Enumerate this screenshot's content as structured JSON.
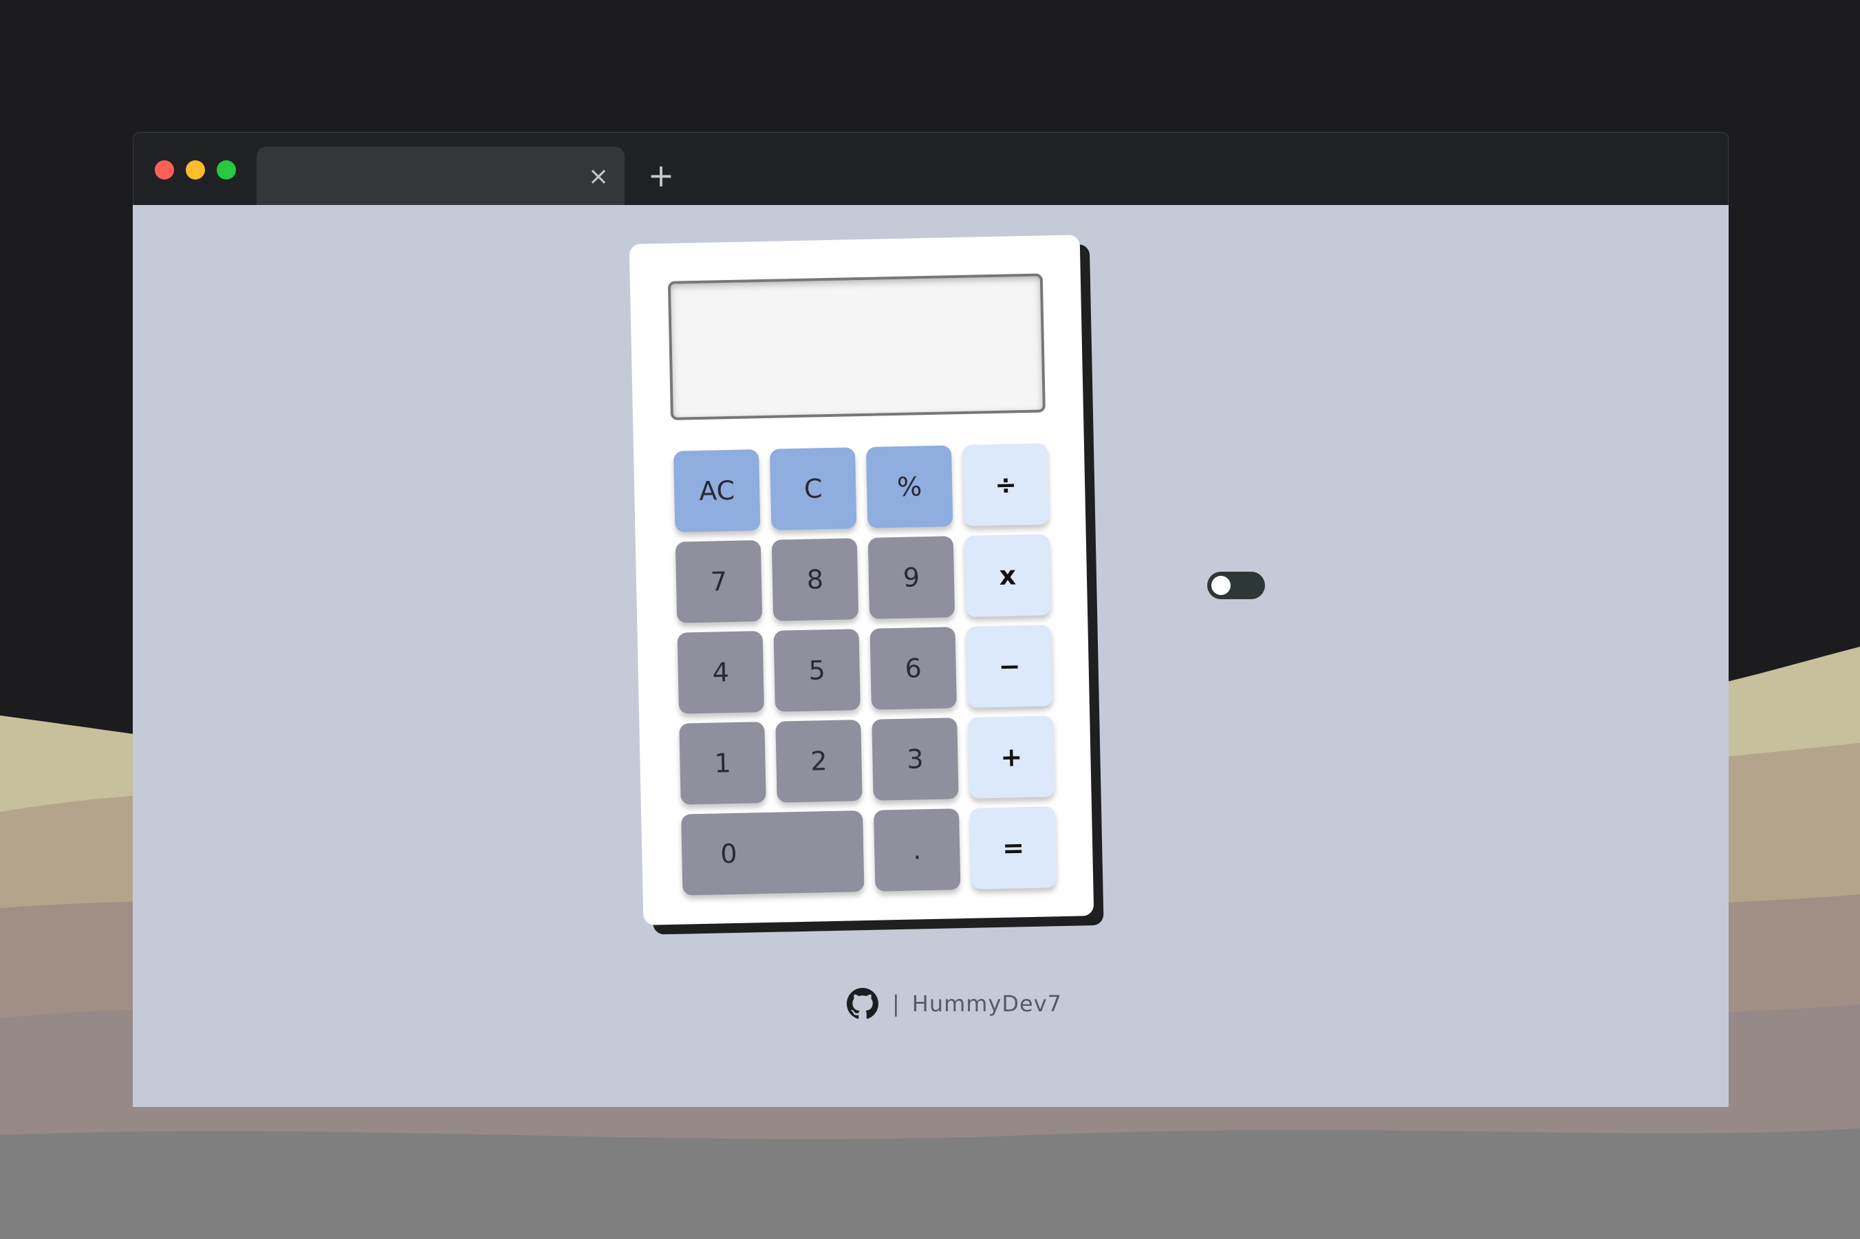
{
  "browser": {
    "tab_title": "",
    "tab_close_label": "×",
    "new_tab_label": "+"
  },
  "calculator": {
    "display_value": "",
    "keys": {
      "ac": "AC",
      "c": "C",
      "percent": "%",
      "divide": "÷",
      "seven": "7",
      "eight": "8",
      "nine": "9",
      "multiply": "x",
      "four": "4",
      "five": "5",
      "six": "6",
      "minus": "−",
      "one": "1",
      "two": "2",
      "three": "3",
      "plus": "+",
      "zero": "0",
      "dot": ".",
      "equals": "="
    }
  },
  "theme_toggle": {
    "state": "off"
  },
  "footer": {
    "icon": "github-icon",
    "separator": "|",
    "author": "HummyDev7"
  },
  "colors": {
    "page_bg": "#c4cad8",
    "fn_key": "#8fadde",
    "num_key": "#8f8f9e",
    "op_key": "#dce9fb"
  }
}
